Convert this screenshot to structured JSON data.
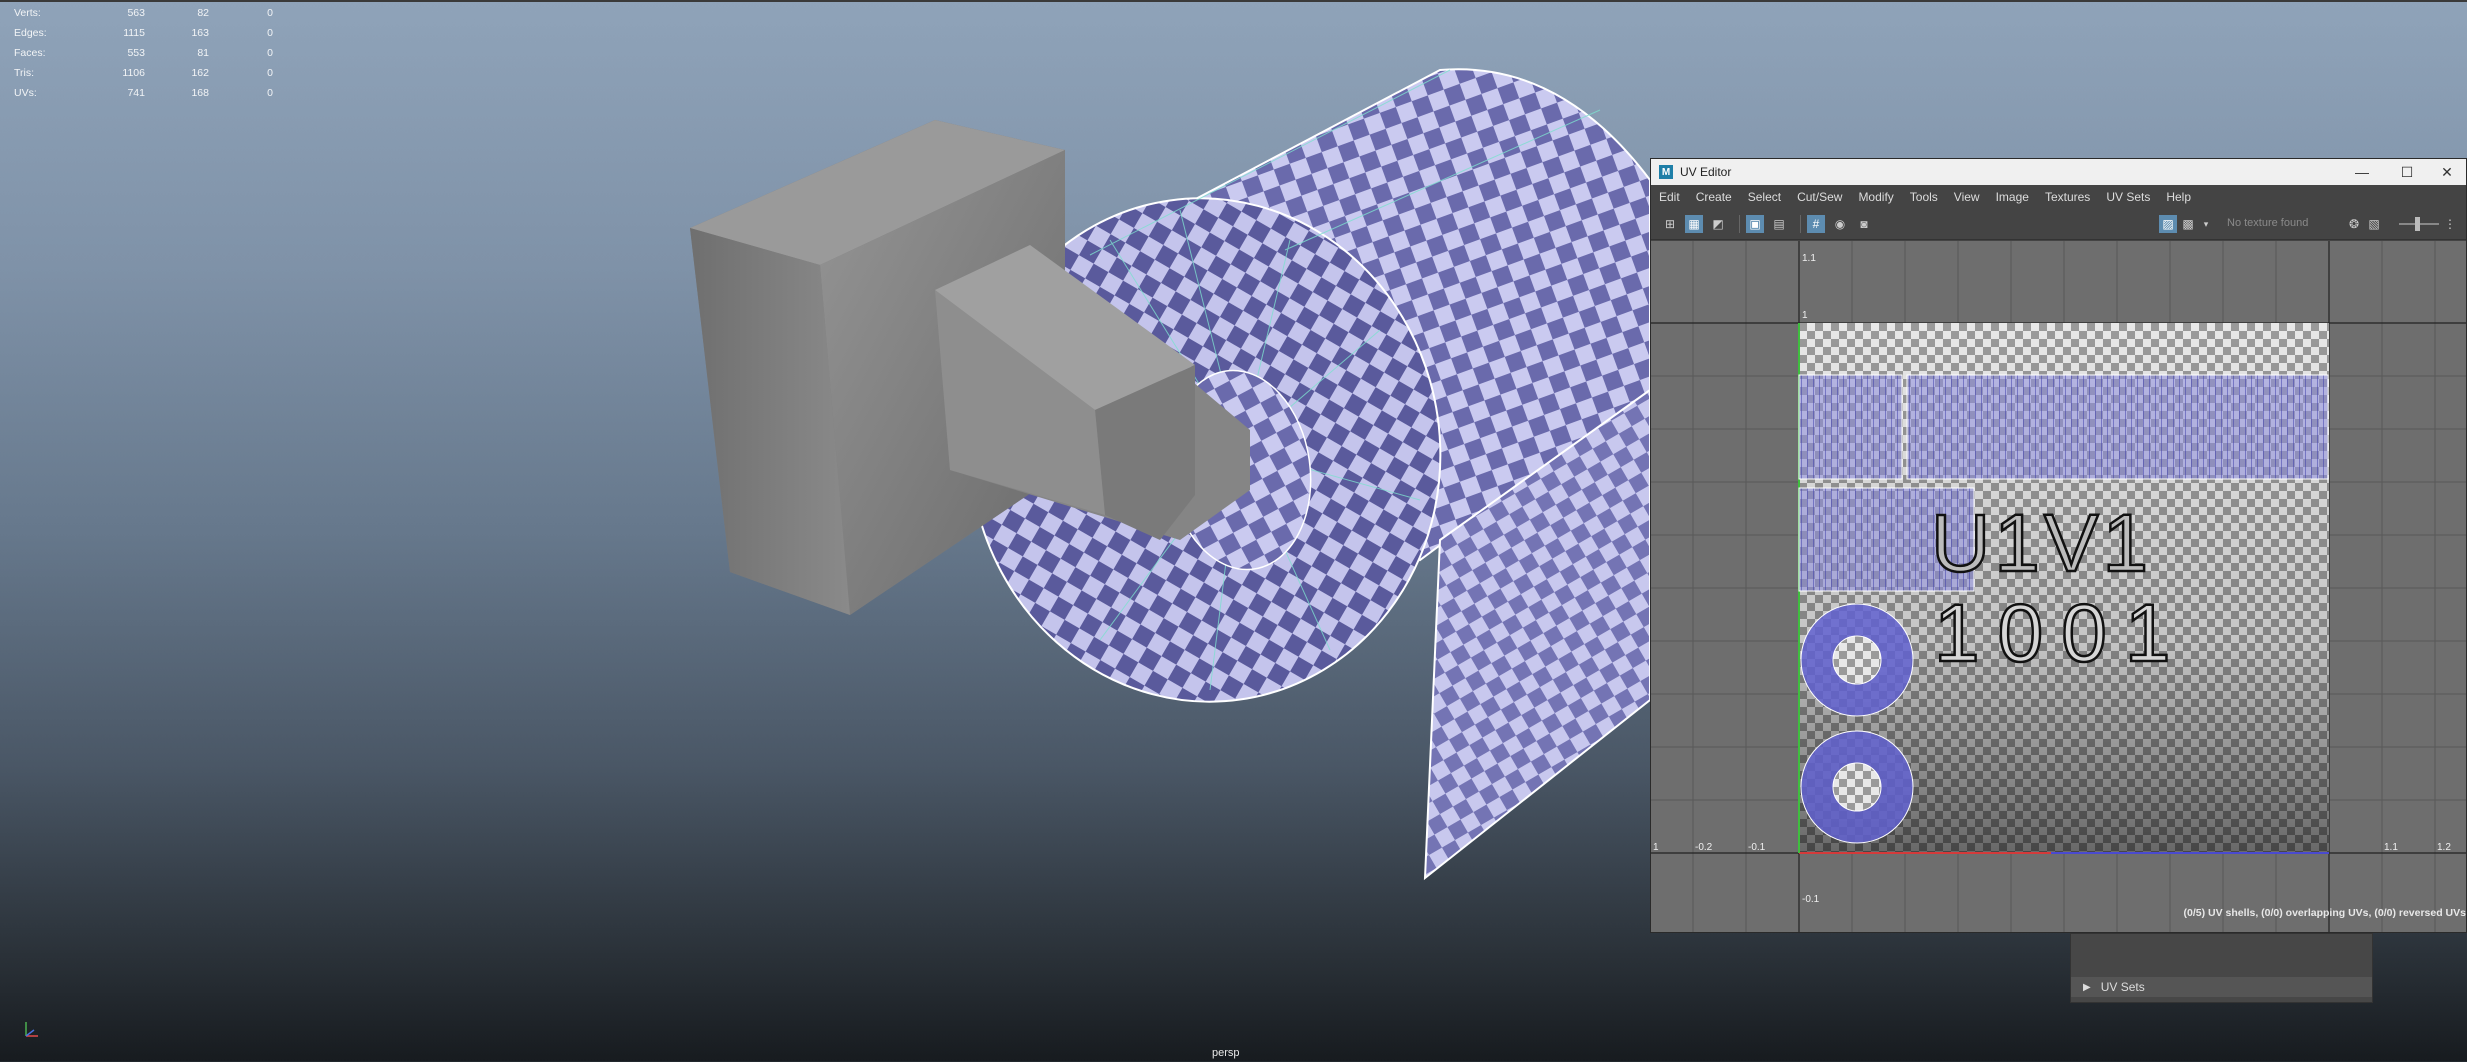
{
  "hud": {
    "rows": [
      {
        "label": "Verts:",
        "v1": "563",
        "v2": "82",
        "v3": "0"
      },
      {
        "label": "Edges:",
        "v1": "1115",
        "v2": "163",
        "v3": "0"
      },
      {
        "label": "Faces:",
        "v1": "553",
        "v2": "81",
        "v3": "0"
      },
      {
        "label": "Tris:",
        "v1": "1106",
        "v2": "162",
        "v3": "0"
      },
      {
        "label": "UVs:",
        "v1": "741",
        "v2": "168",
        "v3": "0"
      }
    ]
  },
  "viewport": {
    "camera_label": "persp",
    "colors": {
      "checker_dark": "#5a5a9c",
      "checker_light": "#c4c4ec",
      "wire": "#7ee0cf"
    }
  },
  "uv_editor": {
    "title": "UV Editor",
    "app_icon": "M",
    "window_buttons": {
      "minimize": "—",
      "maximize": "☐",
      "close": "✕"
    },
    "menu": [
      "Edit",
      "Create",
      "Select",
      "Cut/Sew",
      "Modify",
      "Tools",
      "View",
      "Image",
      "Textures",
      "UV Sets",
      "Help"
    ],
    "texture_status": "No texture found",
    "grid_labels": {
      "top_1_1": "1.1",
      "top_1": "1",
      "left_edge": "1",
      "left_n02": "-0.2",
      "left_n01": "-0.1",
      "right_11": "1.1",
      "right_12": "1.2",
      "bottom_n01": "-0.1"
    },
    "tile_text_line1": "U1V1",
    "tile_text_line2": "1001",
    "status_text": "(0/5) UV shells, (0/0) overlapping UVs, (0/0) reversed UVs"
  },
  "uv_sets_panel": {
    "label": "UV Sets"
  }
}
